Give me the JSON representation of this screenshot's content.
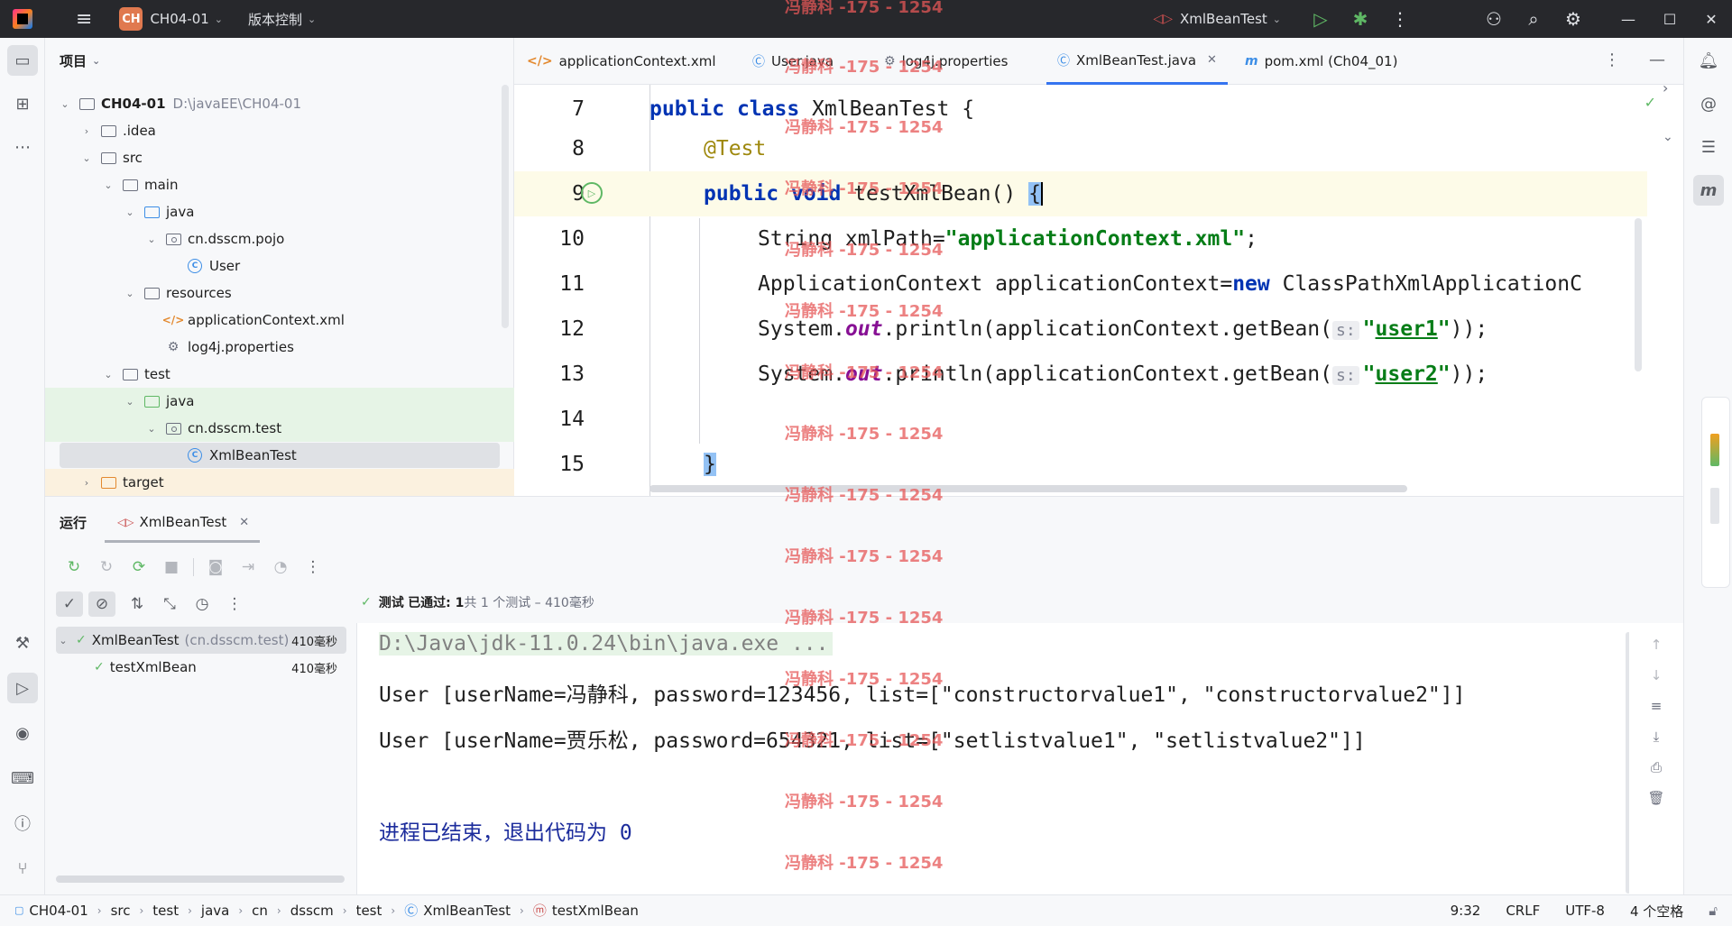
{
  "titlebar": {
    "project_badge": "CH",
    "project_name": "CH04-01",
    "vcs_label": "版本控制",
    "run_config": "XmlBeanTest"
  },
  "project_panel": {
    "title": "项目",
    "tree": [
      {
        "label": "CH04-01",
        "sub": "D:\\javaEE\\CH04-01"
      },
      {
        "label": ".idea"
      },
      {
        "label": "src"
      },
      {
        "label": "main"
      },
      {
        "label": "java"
      },
      {
        "label": "cn.dsscm.pojo"
      },
      {
        "label": "User"
      },
      {
        "label": "resources"
      },
      {
        "label": "applicationContext.xml"
      },
      {
        "label": "log4j.properties"
      },
      {
        "label": "test"
      },
      {
        "label": "java"
      },
      {
        "label": "cn.dsscm.test"
      },
      {
        "label": "XmlBeanTest"
      },
      {
        "label": "target"
      }
    ]
  },
  "editor": {
    "tabs": [
      {
        "label": "applicationContext.xml",
        "icon": "xml-icon"
      },
      {
        "label": "User.java",
        "icon": "class-icon"
      },
      {
        "label": "log4j.properties",
        "icon": "properties-icon"
      },
      {
        "label": "XmlBeanTest.java",
        "icon": "test-class-icon",
        "active": true
      },
      {
        "label": "pom.xml (Ch04_01)",
        "icon": "maven-icon"
      }
    ],
    "line_numbers": [
      "7",
      "8",
      "9",
      "10",
      "11",
      "12",
      "13",
      "14",
      "15"
    ],
    "code": {
      "l7_kw1": "public",
      "l7_kw2": "class",
      "l7_name": " XmlBeanTest {",
      "l8_ann": "@Test",
      "l9_kw1": "public",
      "l9_kw2": "void",
      "l9_name": " testXmlBean() ",
      "l9_brace": "{",
      "l10_pre": "String xmlPath=",
      "l10_str": "\"applicationContext.xml\"",
      "l10_post": ";",
      "l11_pre": "ApplicationContext applicationContext=",
      "l11_kw": "new",
      "l11_post": " ClassPathXmlApplicationC",
      "l12_pre": "System.",
      "l12_fld": "out",
      "l12_mid": ".println(applicationContext.getBean(",
      "l12_hint": "s:",
      "l12_str_q1": "\"",
      "l12_str": "user1",
      "l12_str_q2": "\"",
      "l12_post": "));",
      "l13_pre": "System.",
      "l13_fld": "out",
      "l13_mid": ".println(applicationContext.getBean(",
      "l13_hint": "s:",
      "l13_str_q1": "\"",
      "l13_str": "user2",
      "l13_str_q2": "\"",
      "l13_post": "));",
      "l15_brace": "}"
    }
  },
  "run_panel": {
    "title": "运行",
    "tab_label": "XmlBeanTest",
    "status_prefix": "测试",
    "status_passed": "已通过: 1",
    "status_rest": "共 1 个测试 – 410毫秒",
    "test_tree": [
      {
        "name": "XmlBeanTest",
        "sub": "(cn.dsscm.test)",
        "time": "410毫秒"
      },
      {
        "name": "testXmlBean",
        "time": "410毫秒"
      }
    ],
    "console": [
      "D:\\Java\\jdk-11.0.24\\bin\\java.exe ...",
      "User [userName=冯静科, password=123456, list=[\"constructorvalue1\", \"constructorvalue2\"]]",
      "User [userName=贾乐松, password=654321, list=[\"setlistvalue1\", \"setlistvalue2\"]]",
      "",
      "进程已结束，退出代码为 0"
    ]
  },
  "statusbar": {
    "crumbs": [
      "CH04-01",
      "src",
      "test",
      "java",
      "cn",
      "dsscm",
      "test",
      "XmlBeanTest",
      "testXmlBean"
    ],
    "position": "9:32",
    "line_sep": "CRLF",
    "encoding": "UTF-8",
    "indent": "4 个空格"
  },
  "watermark": "冯静科 -175 - 1254",
  "colors": {
    "keyword": "#0033b3",
    "string": "#067d17",
    "annotation": "#9e880d",
    "accent": "#3574f0",
    "success": "#5fb865"
  }
}
